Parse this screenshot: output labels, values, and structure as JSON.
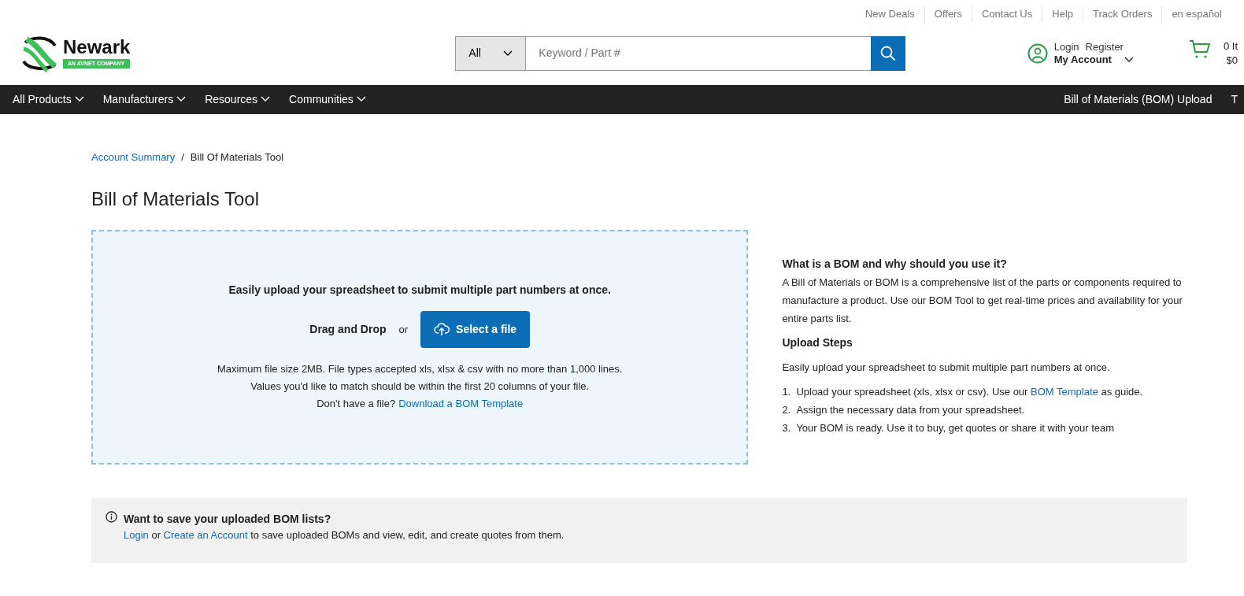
{
  "utility_links": [
    "New Deals",
    "Offers",
    "Contact Us",
    "Help",
    "Track Orders",
    "en español"
  ],
  "logo": {
    "name": "Newark",
    "tagline": "AN AVNET COMPANY"
  },
  "search": {
    "category": "All",
    "placeholder": "Keyword / Part #"
  },
  "account": {
    "login": "Login",
    "register": "Register",
    "my_account": "My Account"
  },
  "cart": {
    "items": "0 It",
    "total": "$0"
  },
  "nav": {
    "items": [
      "All Products",
      "Manufacturers",
      "Resources",
      "Communities"
    ],
    "right": [
      "Bill of Materials (BOM) Upload",
      "T"
    ]
  },
  "breadcrumb": [
    {
      "label": "Account Summary",
      "link": true
    },
    {
      "separator": "/"
    },
    {
      "label": "Bill Of Materials Tool",
      "link": false
    }
  ],
  "title": "Bill of Materials Tool",
  "upload": {
    "headline": "Easily upload your spreadsheet to submit multiple part numbers at once.",
    "drag_text": "Drag and Drop",
    "or_text": "or",
    "button": "Select a file",
    "notes": [
      "Maximum file size 2MB. File types accepted xls, xlsx & csv with no more than 1,000 lines.",
      "Values you'd like to match should be within the first 20 columns of your file."
    ],
    "template_prompt": "Don't have a file?",
    "template_link": "Download a BOM Template"
  },
  "info": {
    "heading": "What is a BOM and why should you use it?",
    "body": "A Bill of Materials or BOM is a comprehensive list of the parts or components required to manufacture a product. Use our BOM Tool to get real-time prices and availability for your entire parts list.",
    "steps_heading": "Upload Steps",
    "steps_intro": "Easily upload your spreadsheet to submit multiple part numbers at once.",
    "steps": [
      {
        "marker": "1.",
        "text": "Upload your spreadsheet (xls, xlsx or csv). Use our ",
        "link": "BOM Template",
        "after": " as guide."
      },
      {
        "marker": "2.",
        "text": "Assign the necessary data from your spreadsheet."
      },
      {
        "marker": "3.",
        "text": "Your BOM is ready. Use it to buy, get quotes or share it with your team"
      }
    ]
  },
  "notice": {
    "heading": "Want to save your uploaded BOM lists?",
    "login_link": "Login",
    "or_text": "or",
    "create_link": "Create an Account",
    "rest": "to save uploaded BOMs and view, edit, and create quotes from them."
  }
}
